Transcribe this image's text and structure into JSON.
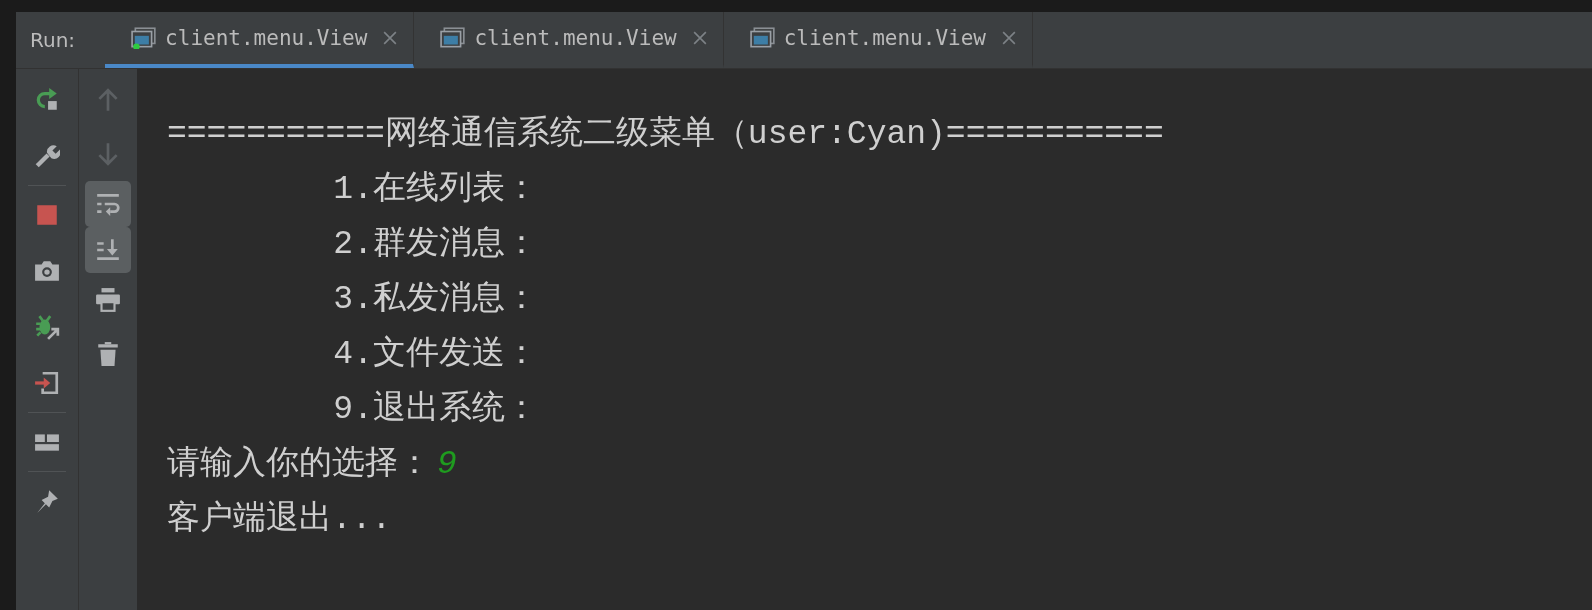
{
  "run_bar": {
    "label": "Run:"
  },
  "tabs": [
    {
      "title": "client.menu.View",
      "selected": true,
      "running": true
    },
    {
      "title": "client.menu.View",
      "selected": false,
      "running": false
    },
    {
      "title": "client.menu.View",
      "selected": false,
      "running": false
    }
  ],
  "console": {
    "lines": [
      {
        "kind": "heading",
        "text": "===========网络通信系统二级菜单（user:Cyan)==========="
      },
      {
        "kind": "item",
        "text": "1.在线列表："
      },
      {
        "kind": "item",
        "text": "2.群发消息："
      },
      {
        "kind": "item",
        "text": "3.私发消息："
      },
      {
        "kind": "item",
        "text": "4.文件发送："
      },
      {
        "kind": "item",
        "text": "9.退出系统："
      },
      {
        "kind": "prompt",
        "text": "请输入你的选择：",
        "input": "9"
      },
      {
        "kind": "output",
        "text": "客户端退出..."
      }
    ]
  }
}
